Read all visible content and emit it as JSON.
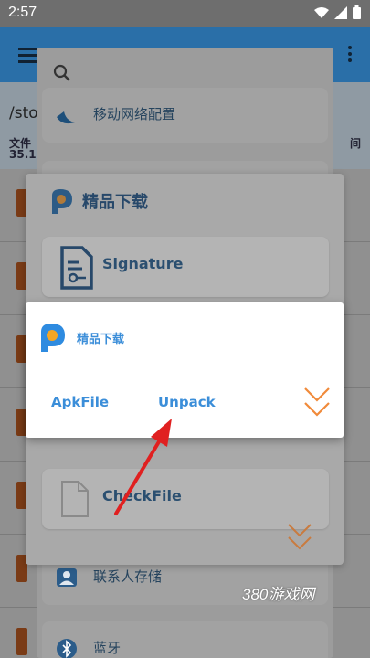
{
  "status_bar": {
    "time": "2:57",
    "icons": [
      "wifi-icon",
      "signal-icon",
      "battery-icon"
    ]
  },
  "background_app": {
    "path_prefix": "/sto",
    "info_line1": "文件",
    "info_line2": "35.1",
    "info_right": "间"
  },
  "panel3": {
    "cards": [
      {
        "label": "移动网络配置",
        "icon": "network-icon"
      },
      {
        "label": "",
        "icon": "file-icon"
      },
      {
        "label": "联系人存储",
        "icon": "contacts-icon"
      },
      {
        "label": "蓝牙",
        "icon": "bluetooth-icon"
      }
    ]
  },
  "panel2": {
    "title": "精品下载",
    "items": [
      {
        "label": "Signature",
        "icon": "signature-file-icon"
      },
      {
        "label": "CheckFile",
        "icon": "document-icon"
      }
    ]
  },
  "dialog": {
    "title": "精品下载",
    "options": [
      "ApkFile",
      "Unpack"
    ],
    "accent_color": "#3b8ed9",
    "chevron_color": "#f08a3a"
  },
  "watermark": "380游戏网"
}
